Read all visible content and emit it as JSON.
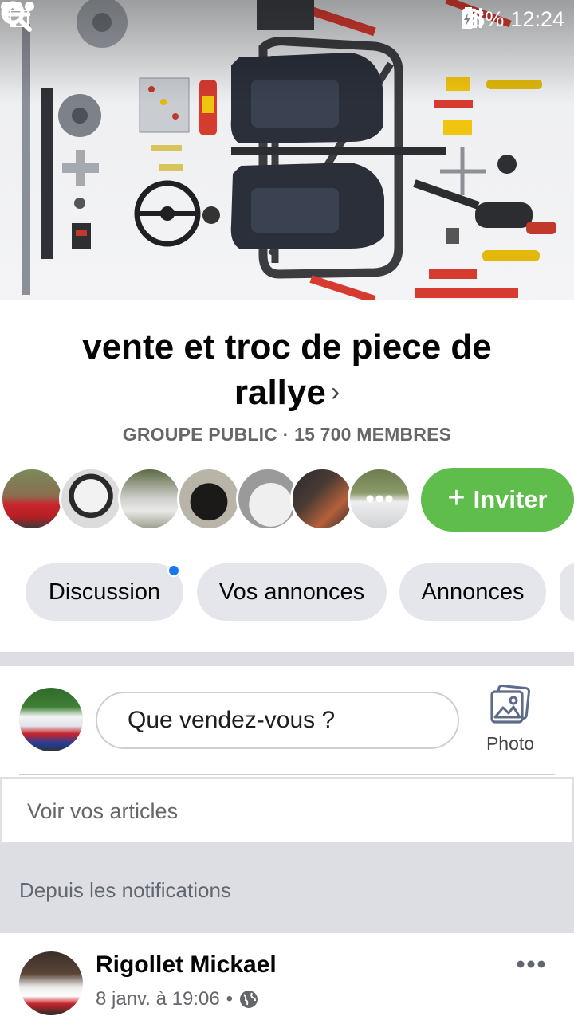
{
  "status_bar": {
    "battery": "85%",
    "time": "12:24"
  },
  "group": {
    "title": "vente et troc de piece de rallye",
    "chevron": "›",
    "meta": "GROUPE PUBLIC · 15 700 MEMBRES"
  },
  "invite": {
    "label": "Inviter",
    "plus": "+"
  },
  "tabs": [
    {
      "label": "Discussion",
      "has_notification_dot": true
    },
    {
      "label": "Vos annonces"
    },
    {
      "label": "Annonces"
    }
  ],
  "composer": {
    "prompt": "Que vendez-vous ?",
    "photo_label": "Photo"
  },
  "view_items_label": "Voir vos articles",
  "notifications_header": "Depuis les notifications",
  "post": {
    "author": "Rigollet Mickael",
    "date": "8 janv. à 19:06",
    "separator": "•"
  },
  "colors": {
    "invite_green": "#5ebd4b",
    "notification_blue": "#1877f2",
    "chip_gray": "#e4e6eb",
    "meta_gray": "#65676b"
  }
}
